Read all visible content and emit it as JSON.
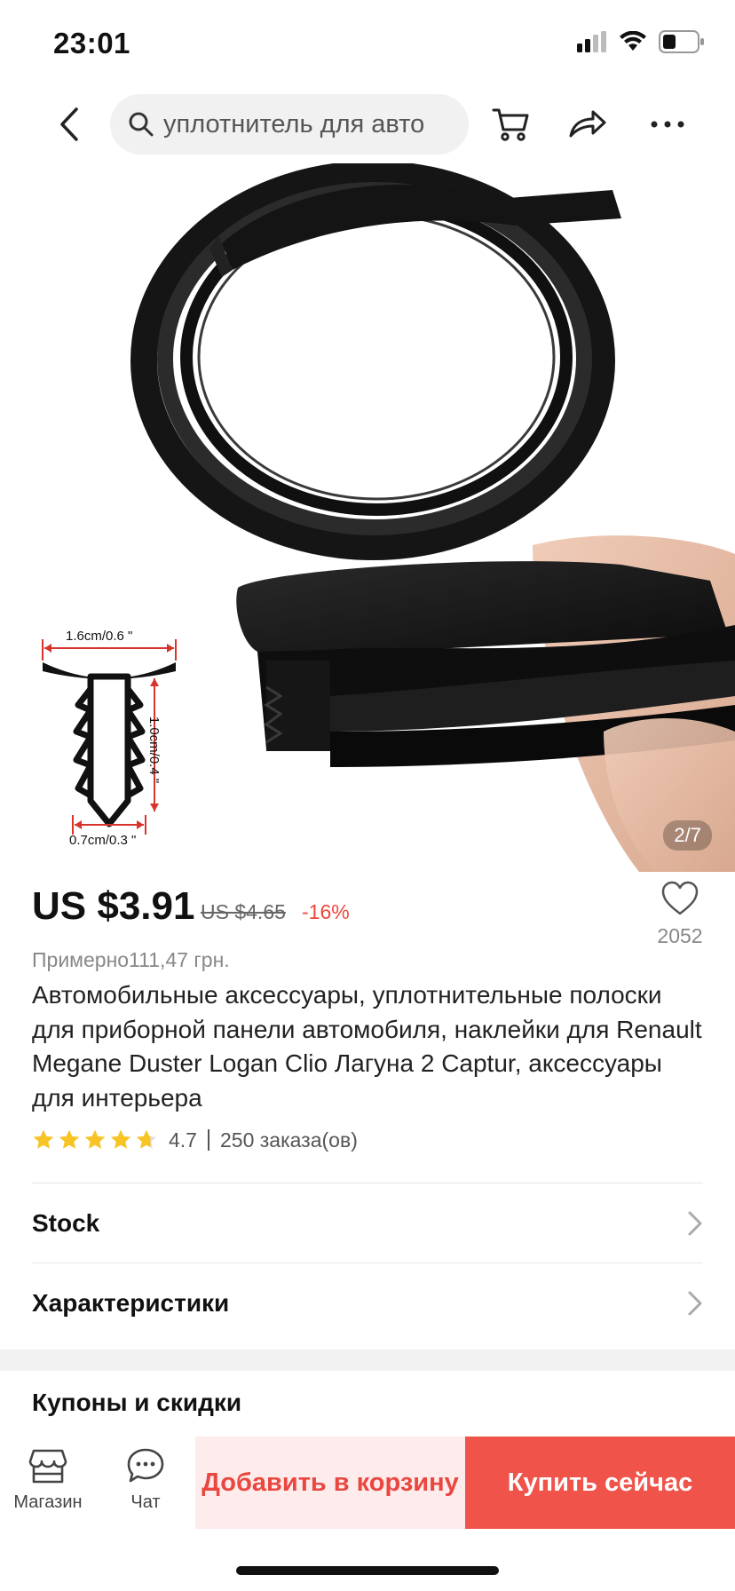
{
  "status": {
    "time": "23:01"
  },
  "search": {
    "query": "уплотнитель для авто"
  },
  "gallery": {
    "counter": "2/7",
    "dimension_width_top": "1.6cm/0.6 \"",
    "dimension_height": "1.0cm/0.4 \"",
    "dimension_width_bottom": "0.7cm/0.3 \""
  },
  "product": {
    "price": "US $3.91",
    "old_price": "US $4.65",
    "discount": "-16%",
    "wishlist_count": "2052",
    "approx_price": "Примерно111,47 грн.",
    "title": "Автомобильные аксессуары, уплотнительные полоски для приборной панели автомобиля, наклейки для Renault Megane Duster Logan Clio Лагуна 2 Captur, аксессуары для интерьера",
    "rating": 4.7,
    "rating_text": "4.7",
    "orders": "250 заказа(ов)"
  },
  "rows": {
    "stock": "Stock",
    "specs": "Характеристики",
    "coupons": "Купоны и скидки"
  },
  "bottom": {
    "store_label": "Магазин",
    "chat_label": "Чат",
    "add_to_cart": "Добавить в корзину",
    "buy_now": "Купить сейчас"
  },
  "colors": {
    "accent": "#ef534a",
    "discount": "#f0463c",
    "cart_bg": "#fdeceb",
    "star": "#f7c325"
  }
}
